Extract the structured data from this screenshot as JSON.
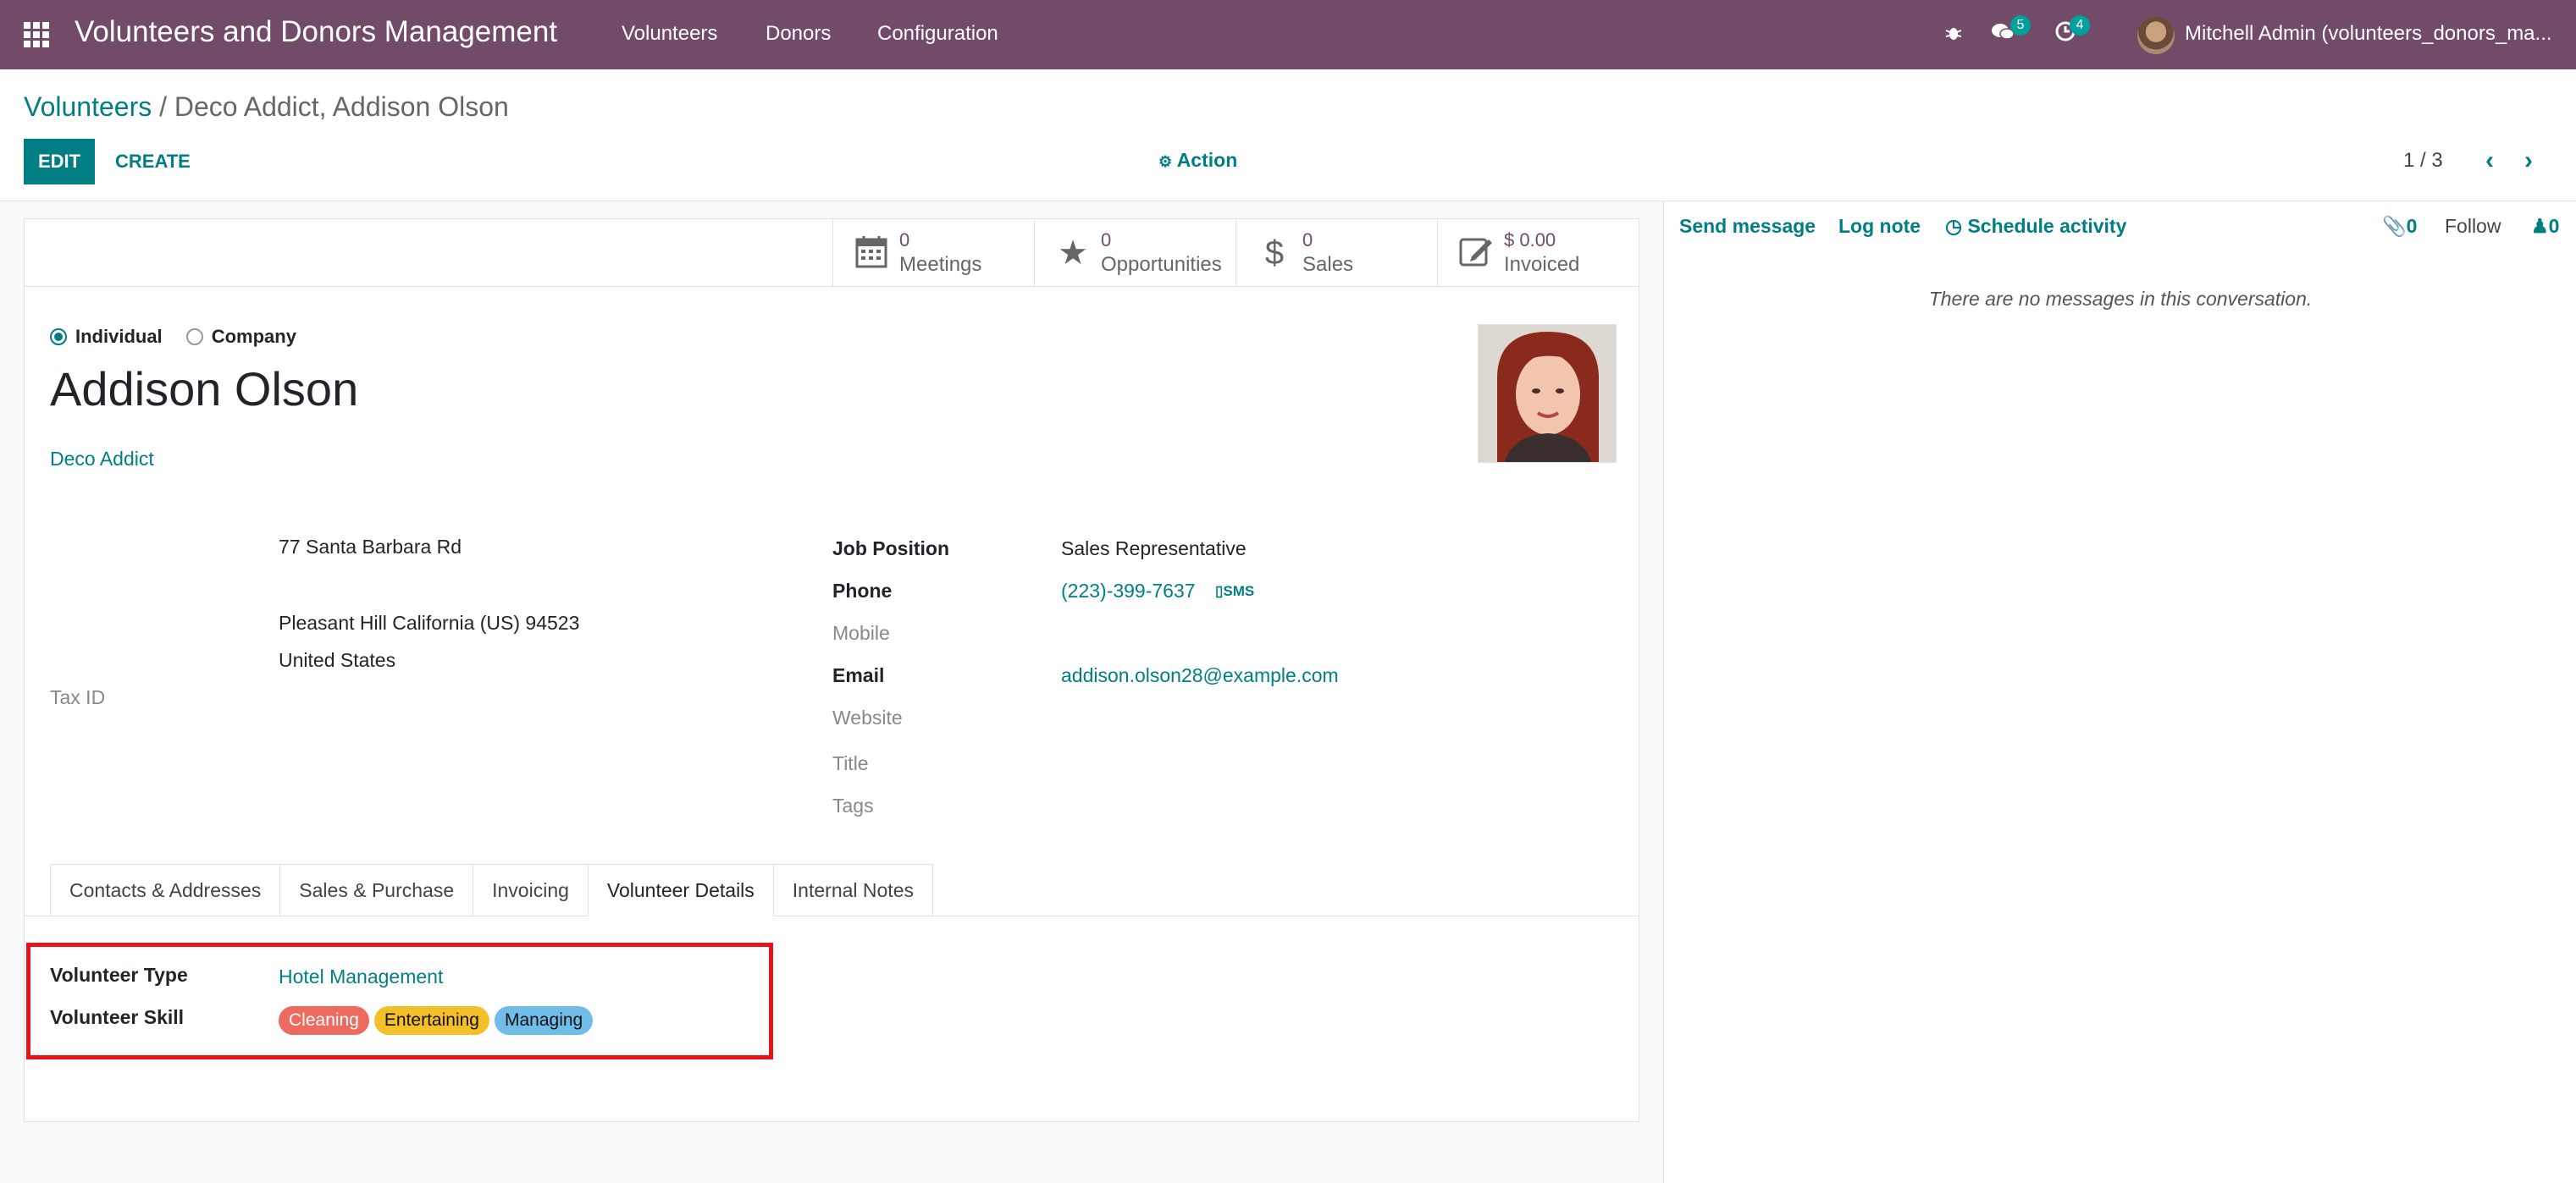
{
  "app": {
    "title": "Volunteers and Donors Management",
    "menus": [
      "Volunteers",
      "Donors",
      "Configuration"
    ],
    "messages_count": "5",
    "activities_count": "4",
    "user": "Mitchell Admin (volunteers_donors_ma..."
  },
  "control": {
    "breadcrumb_parent": "Volunteers",
    "breadcrumb_sep": " / ",
    "breadcrumb_current": "Deco Addict, Addison Olson",
    "edit": "EDIT",
    "create": "CREATE",
    "action": "Action",
    "pager": "1 / 3"
  },
  "smart_buttons": [
    {
      "icon": "calendar-icon",
      "value": "0",
      "label": "Meetings"
    },
    {
      "icon": "star-icon",
      "value": "0",
      "label": "Opportunities"
    },
    {
      "icon": "dollar-icon",
      "value": "0",
      "label": "Sales"
    },
    {
      "icon": "invoice-icon",
      "value": "$ 0.00",
      "label": "Invoiced"
    }
  ],
  "partner": {
    "type_individual": "Individual",
    "type_company": "Company",
    "selected_type": "Individual",
    "name": "Addison Olson",
    "company": "Deco Addict",
    "street": "77 Santa Barbara Rd",
    "city_line": "Pleasant Hill  California (US)  94523",
    "country": "United States",
    "tax_id_label": "Tax ID",
    "job_position_label": "Job Position",
    "job_position": "Sales Representative",
    "phone_label": "Phone",
    "phone": "(223)-399-7637",
    "sms": "SMS",
    "mobile_label": "Mobile",
    "email_label": "Email",
    "email": "addison.olson28@example.com",
    "website_label": "Website",
    "title_label": "Title",
    "tags_label": "Tags"
  },
  "tabs": [
    "Contacts & Addresses",
    "Sales & Purchase",
    "Invoicing",
    "Volunteer Details",
    "Internal Notes"
  ],
  "active_tab": "Volunteer Details",
  "volunteer": {
    "type_label": "Volunteer Type",
    "type": "Hotel Management",
    "skill_label": "Volunteer Skill",
    "skills": [
      {
        "name": "Cleaning",
        "color": "#ee6a5e"
      },
      {
        "name": "Entertaining",
        "color": "#f4c02a"
      },
      {
        "name": "Managing",
        "color": "#6fbde8"
      }
    ]
  },
  "chatter": {
    "send_message": "Send message",
    "log_note": "Log note",
    "schedule_activity": "Schedule activity",
    "attachments": "0",
    "follow": "Follow",
    "followers": "0",
    "empty": "There are no messages in this conversation."
  },
  "colors": {
    "navbar": "#714b67",
    "primary": "#017e84",
    "highlight": "#e8141b"
  }
}
